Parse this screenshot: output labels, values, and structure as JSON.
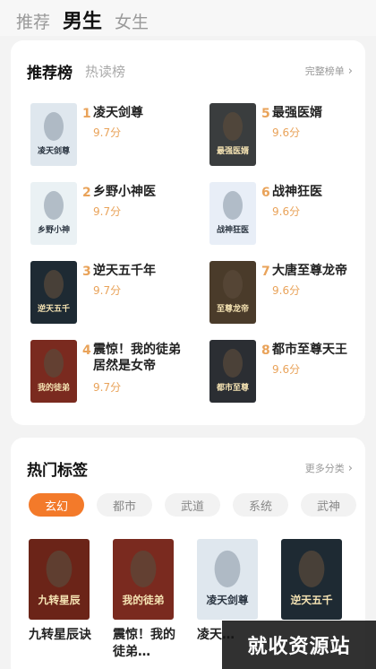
{
  "top_tabs": [
    "推荐",
    "男生",
    "女生"
  ],
  "rank_card": {
    "tab_recommend": "推荐榜",
    "tab_hot": "热读榜",
    "more": "完整榜单",
    "items": [
      {
        "num": "1",
        "title": "凌天剑尊",
        "score": "9.7分",
        "cover_color": "#dfe7ee",
        "cover_text": "凌天剑尊"
      },
      {
        "num": "2",
        "title": "乡野小神医",
        "score": "9.7分",
        "cover_color": "#eaf1f4",
        "cover_text": "乡野小神医"
      },
      {
        "num": "3",
        "title": "逆天五千年",
        "score": "9.7分",
        "cover_color": "#1e2a33",
        "cover_text": "逆天五千年"
      },
      {
        "num": "4",
        "title": "震惊！我的徒弟居然是女帝",
        "score": "9.7分",
        "cover_color": "#7a2a1f",
        "cover_text": "我的徒弟居然是女帝"
      },
      {
        "num": "5",
        "title": "最强医婿",
        "score": "9.6分",
        "cover_color": "#3a3d3e",
        "cover_text": "最强医婿"
      },
      {
        "num": "6",
        "title": "战神狂医",
        "score": "9.6分",
        "cover_color": "#e8eef7",
        "cover_text": "战神狂医"
      },
      {
        "num": "7",
        "title": "大唐至尊龙帝",
        "score": "9.6分",
        "cover_color": "#4a3b2a",
        "cover_text": "至尊龙帝"
      },
      {
        "num": "8",
        "title": "都市至尊天王",
        "score": "9.6分",
        "cover_color": "#2b2e33",
        "cover_text": "都市至尊天王"
      }
    ]
  },
  "tags_card": {
    "title": "热门标签",
    "more": "更多分类",
    "chips": [
      "玄幻",
      "都市",
      "武道",
      "系统",
      "武神"
    ],
    "books": [
      {
        "title": "九转星辰诀",
        "meta": "",
        "cover_color": "#6b2418",
        "cover_text": "九转星辰诀"
      },
      {
        "title": "震惊！我的徒弟…",
        "meta": "",
        "cover_color": "#7a2a1f",
        "cover_text": "我的徒弟居然是女帝"
      },
      {
        "title": "凌天…",
        "meta": "",
        "cover_color": "#dfe7ee",
        "cover_text": "凌天剑尊"
      },
      {
        "title": "",
        "meta": "",
        "cover_color": "#1e2a33",
        "cover_text": "逆天五千年"
      }
    ]
  },
  "watermark": "就收资源站"
}
